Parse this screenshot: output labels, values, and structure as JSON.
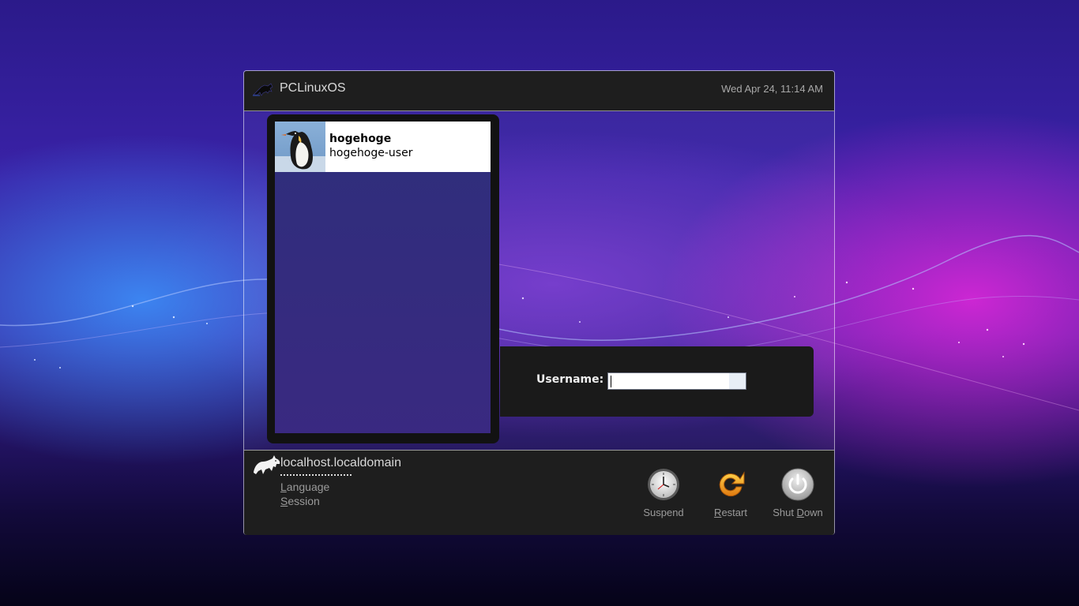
{
  "header": {
    "brand": "PCLinuxOS",
    "datetime": "Wed Apr 24, 11:14 AM"
  },
  "users": [
    {
      "display_name": "hogehoge",
      "login": "hogehoge-user",
      "avatar_icon": "penguin-avatar"
    }
  ],
  "login": {
    "username_label": "Username:",
    "username_value": "",
    "username_placeholder": ""
  },
  "footer": {
    "hostname": "localhost.localdomain",
    "language_mnemonic": "L",
    "language_rest": "anguage",
    "session_mnemonic": "S",
    "session_rest": "ession",
    "suspend_label": "Suspend",
    "restart_mnemonic": "R",
    "restart_rest": "estart",
    "shutdown_pre": "Shut ",
    "shutdown_mnemonic": "D",
    "shutdown_rest": "own",
    "icons": [
      "clock-icon",
      "restart-icon",
      "power-icon"
    ]
  },
  "colors": {
    "panel": "#1e1e1e",
    "restart_accent": "#f0a020",
    "text_muted": "#9a9a9a"
  }
}
